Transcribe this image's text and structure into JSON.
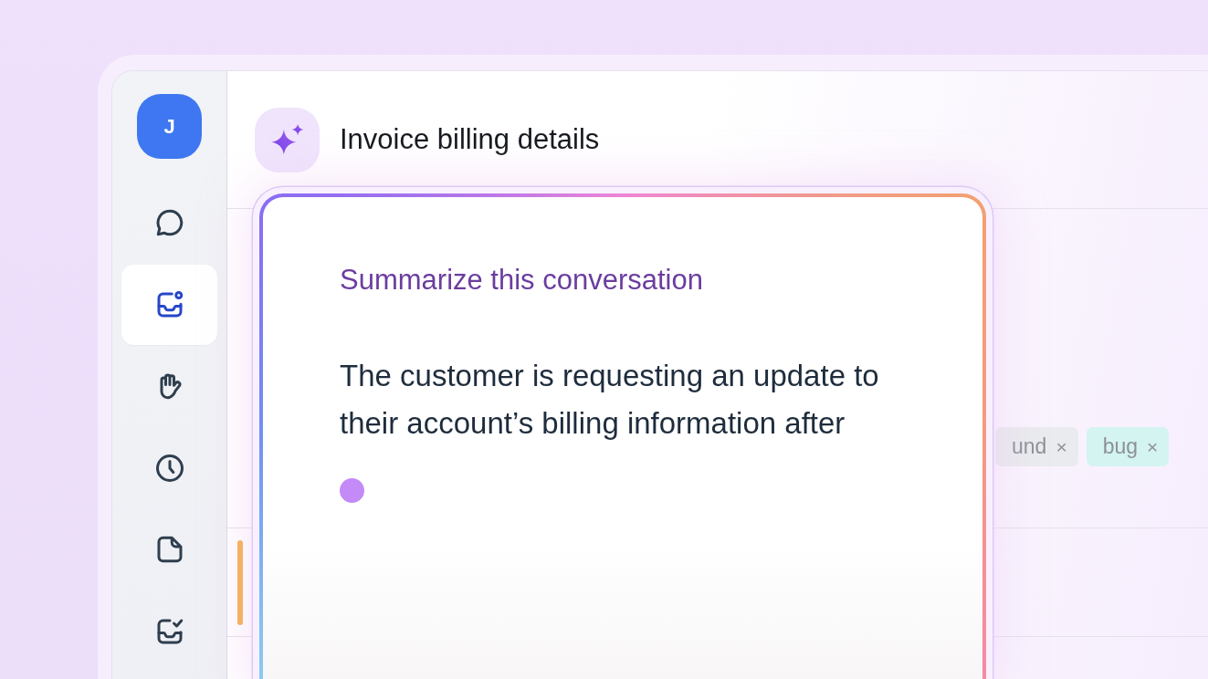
{
  "sidebar": {
    "avatar": "J",
    "items": [
      {
        "selected": false
      },
      {
        "selected": true
      },
      {
        "selected": false
      },
      {
        "selected": false
      },
      {
        "selected": false
      },
      {
        "selected": false
      }
    ]
  },
  "header": {
    "title": "Invoice billing details"
  },
  "tags": [
    {
      "label": "und",
      "remove": "×",
      "color": "#e9ebee"
    },
    {
      "label": "bug",
      "remove": "×",
      "color": "#d3f4f1"
    }
  ],
  "summary": {
    "prompt": "Summarize this conversation",
    "text": "The customer is requesting an update to their account’s billing information after",
    "generating": true
  }
}
